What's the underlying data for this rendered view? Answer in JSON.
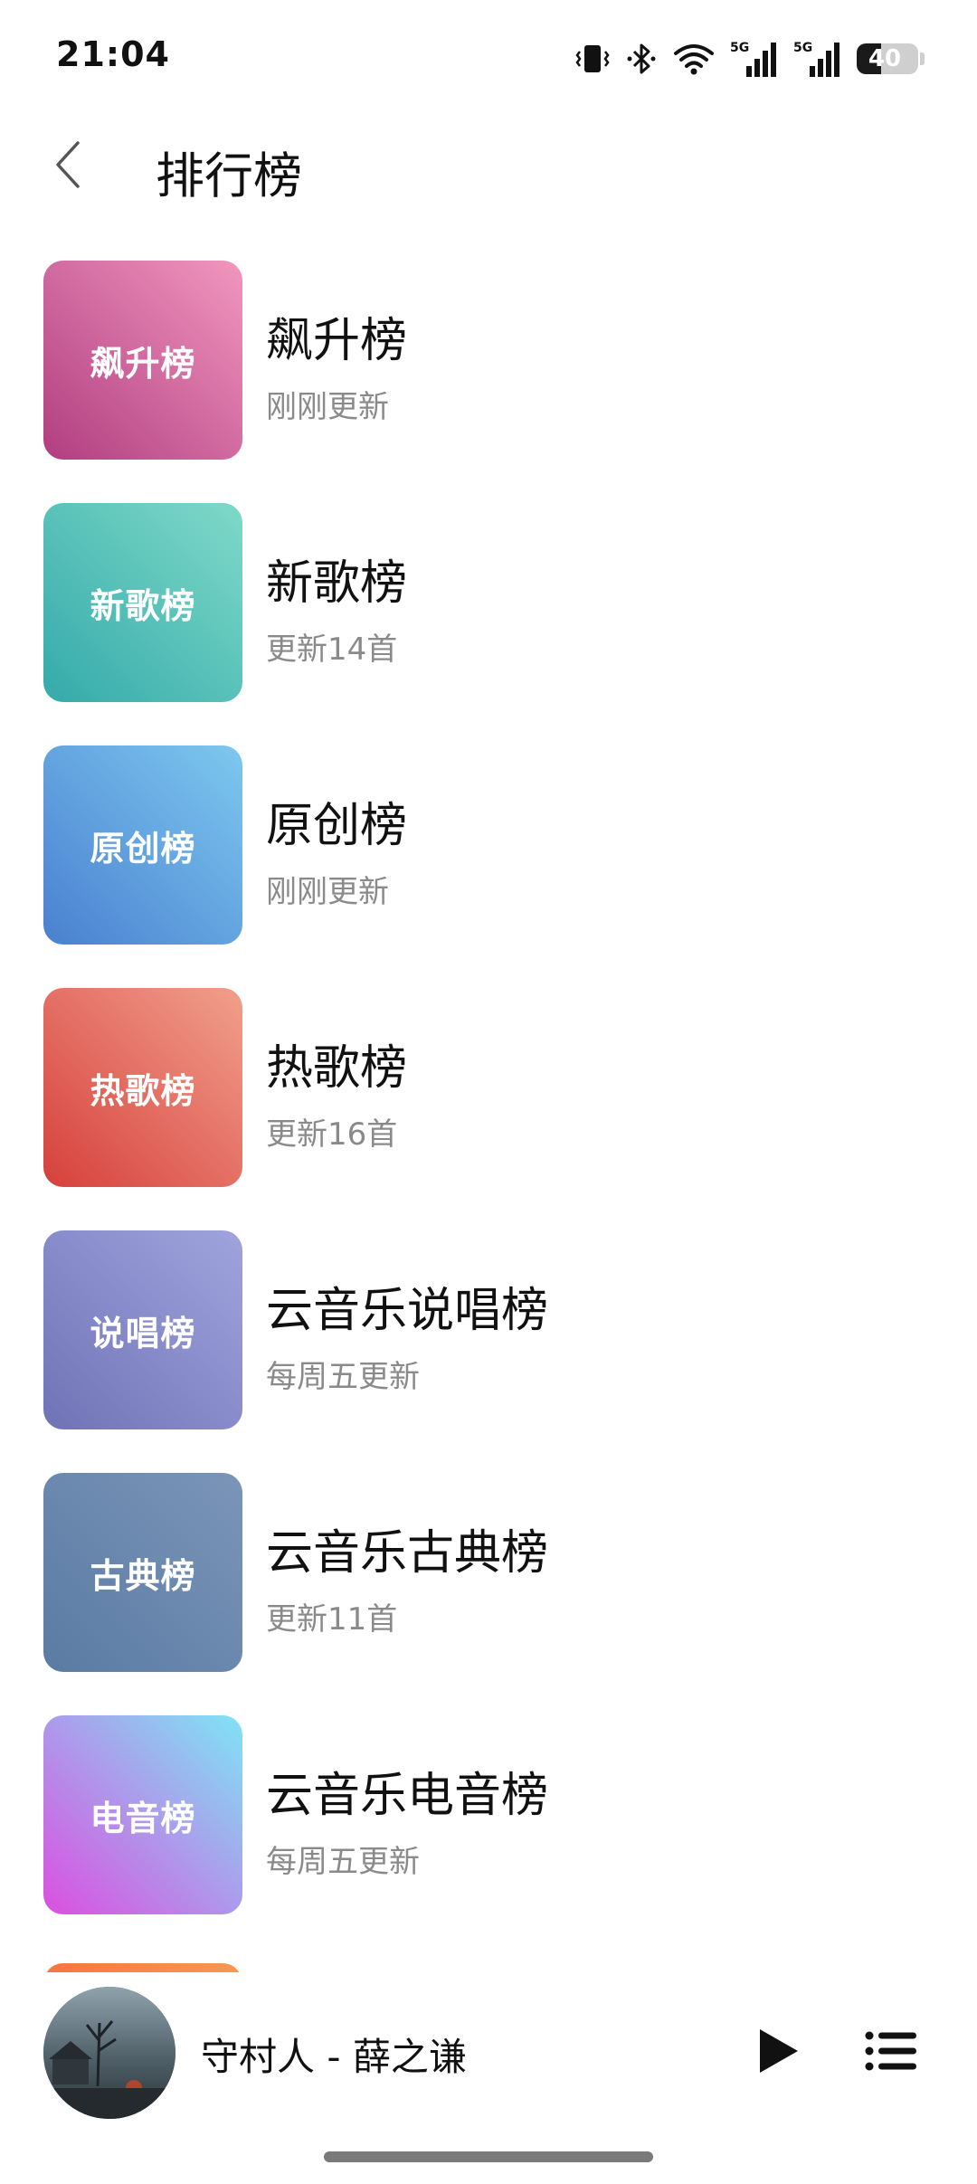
{
  "status_bar": {
    "time": "21:04",
    "icons": [
      "vibrate-icon",
      "bluetooth-icon",
      "wifi-icon",
      "signal-5g-icon",
      "signal-5g-icon"
    ],
    "battery_level": "40",
    "battery_fraction": 0.4
  },
  "header": {
    "back_icon": "chevron-left-icon",
    "title": "排行榜"
  },
  "rankings": [
    {
      "cover_text": "飙升榜",
      "title": "飙升榜",
      "subtitle": "刚刚更新",
      "gradient": [
        "#b13e80",
        "#f197bf"
      ]
    },
    {
      "cover_text": "新歌榜",
      "title": "新歌榜",
      "subtitle": "更新14首",
      "gradient": [
        "#34aaaa",
        "#7fd9c8"
      ]
    },
    {
      "cover_text": "原创榜",
      "title": "原创榜",
      "subtitle": "刚刚更新",
      "gradient": [
        "#4a80d0",
        "#7dc8ef"
      ]
    },
    {
      "cover_text": "热歌榜",
      "title": "热歌榜",
      "subtitle": "更新16首",
      "gradient": [
        "#d6403c",
        "#f1a08c"
      ]
    },
    {
      "cover_text": "说唱榜",
      "title": "云音乐说唱榜",
      "subtitle": "每周五更新",
      "gradient": [
        "#6f73b6",
        "#a0a4dd"
      ]
    },
    {
      "cover_text": "古典榜",
      "title": "云音乐古典榜",
      "subtitle": "更新11首",
      "gradient": [
        "#5a7ba3",
        "#7b95b8"
      ]
    },
    {
      "cover_text": "电音榜",
      "title": "云音乐电音榜",
      "subtitle": "每周五更新",
      "gradient": [
        "#dc4fe0",
        "#7fe4f5"
      ]
    }
  ],
  "player": {
    "song": "守村人 - 薛之谦",
    "play_icon": "play-icon",
    "playlist_icon": "playlist-icon"
  }
}
